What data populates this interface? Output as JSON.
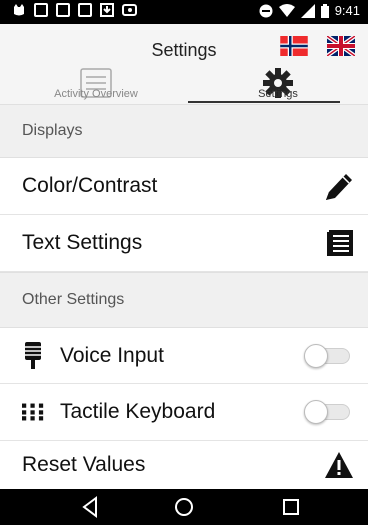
{
  "status_bar": {
    "time": "9:41",
    "icons": [
      "cat-icon",
      "image-icon",
      "instagram-icon",
      "instagram-icon",
      "download-icon",
      "cloud-icon",
      "minus-circle-icon",
      "wifi-icon",
      "signal-icon",
      "battery-icon"
    ]
  },
  "app_bar": {
    "title": "Settings",
    "flags": [
      "norway-flag-icon",
      "uk-flag-icon"
    ]
  },
  "tabs": [
    {
      "label": "Activity Overview",
      "icon": "list-icon",
      "selected": false
    },
    {
      "label": "Settings",
      "icon": "gear-icon",
      "selected": true
    }
  ],
  "sections": [
    {
      "header": "Displays",
      "items": [
        {
          "label": "Color/Contrast",
          "icon": "pencil-icon",
          "type": "link"
        },
        {
          "label": "Text Settings",
          "icon": "document-lines-icon",
          "type": "link"
        }
      ]
    },
    {
      "header": "Other Settings",
      "items": [
        {
          "label": "Voice Input",
          "icon": "microphone-icon",
          "type": "toggle",
          "on": false
        },
        {
          "label": "Tactile Keyboard",
          "icon": "keypad-icon",
          "type": "toggle",
          "on": false
        },
        {
          "label": "Reset Values",
          "icon": "warning-icon",
          "type": "link"
        }
      ]
    }
  ],
  "nav_bar": [
    "back-icon",
    "home-icon",
    "recents-icon"
  ],
  "colors": {
    "status_bar": "#000000",
    "app_bar": "#f5f5f5",
    "section_bg": "#f0f0f0",
    "text": "#111111"
  }
}
